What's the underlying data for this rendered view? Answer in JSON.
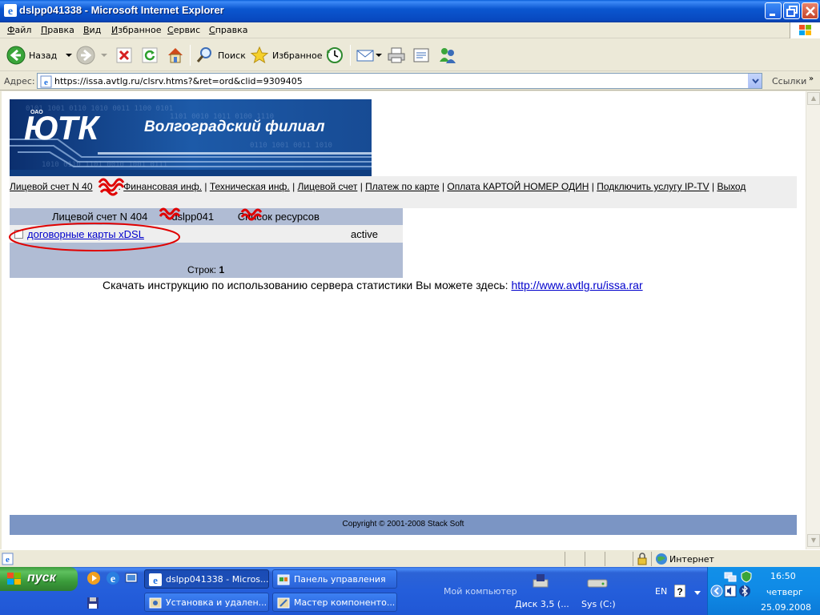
{
  "window": {
    "title": "dslpp041338 - Microsoft Internet Explorer"
  },
  "menu": {
    "items": [
      "Файл",
      "Правка",
      "Вид",
      "Избранное",
      "Сервис",
      "Справка"
    ],
    "underlined": [
      "Ф",
      "П",
      "В",
      "И",
      "С",
      "С"
    ],
    "rest": [
      "айл",
      "равка",
      "ид",
      "збранное",
      "ервис",
      "правка"
    ]
  },
  "toolbar": {
    "back_label": "Назад",
    "search_label": "Поиск",
    "favorites_label": "Избранное"
  },
  "address": {
    "label": "Адрес:",
    "url": "https://issa.avtlg.ru/clsrv.htms?&ret=ord&clid=9309405",
    "links_label": "Ссылки"
  },
  "banner": {
    "logo_text": "ЮТК",
    "oao": "ОАО",
    "subtitle": "Волгоградский филиал"
  },
  "nav": {
    "account_label": "Лицевой счет N 40",
    "links": [
      "Финансовая инф.",
      "Техническая инф.",
      "Лицевой счет",
      "Платеж по карте",
      "Оплата КАРТОЙ НОМЕР ОДИН",
      "Подключить услугу IP-TV",
      "Выход"
    ]
  },
  "resources": {
    "header_prefix": "Лицевой счет N 404",
    "header_mid": "- dslpp041",
    "header_suffix": " Список ресурсов",
    "row_link": "договорные карты xDSL",
    "row_status": "active",
    "count_label": "Строк:",
    "count_value": "1"
  },
  "download": {
    "text": "Скачать инструкцию по использованию сервера статистики Вы можете здесь: ",
    "link": "http://www.avtlg.ru/issa.rar"
  },
  "footer": {
    "copyright": "Copyright © 2001-2008 Stack Soft"
  },
  "statusbar": {
    "zone": "Интернет"
  },
  "taskbar": {
    "start_label": "пуск",
    "buttons": [
      "dslpp041338 - Micros...",
      "Панель управления",
      "Установка и удален...",
      "Мастер компоненто..."
    ],
    "desktop_my_computer": "Мой компьютер",
    "drive_a": "Диск 3,5 (...",
    "drive_c": "Sys (C:)",
    "lang": "EN",
    "time": "16:50",
    "day": "четверг",
    "date": "25.09.2008"
  },
  "colors": {
    "table_header": "#b0bcd4",
    "footer_bar": "#7b95c4",
    "link": "#0000cc",
    "annotation": "#e00000"
  }
}
